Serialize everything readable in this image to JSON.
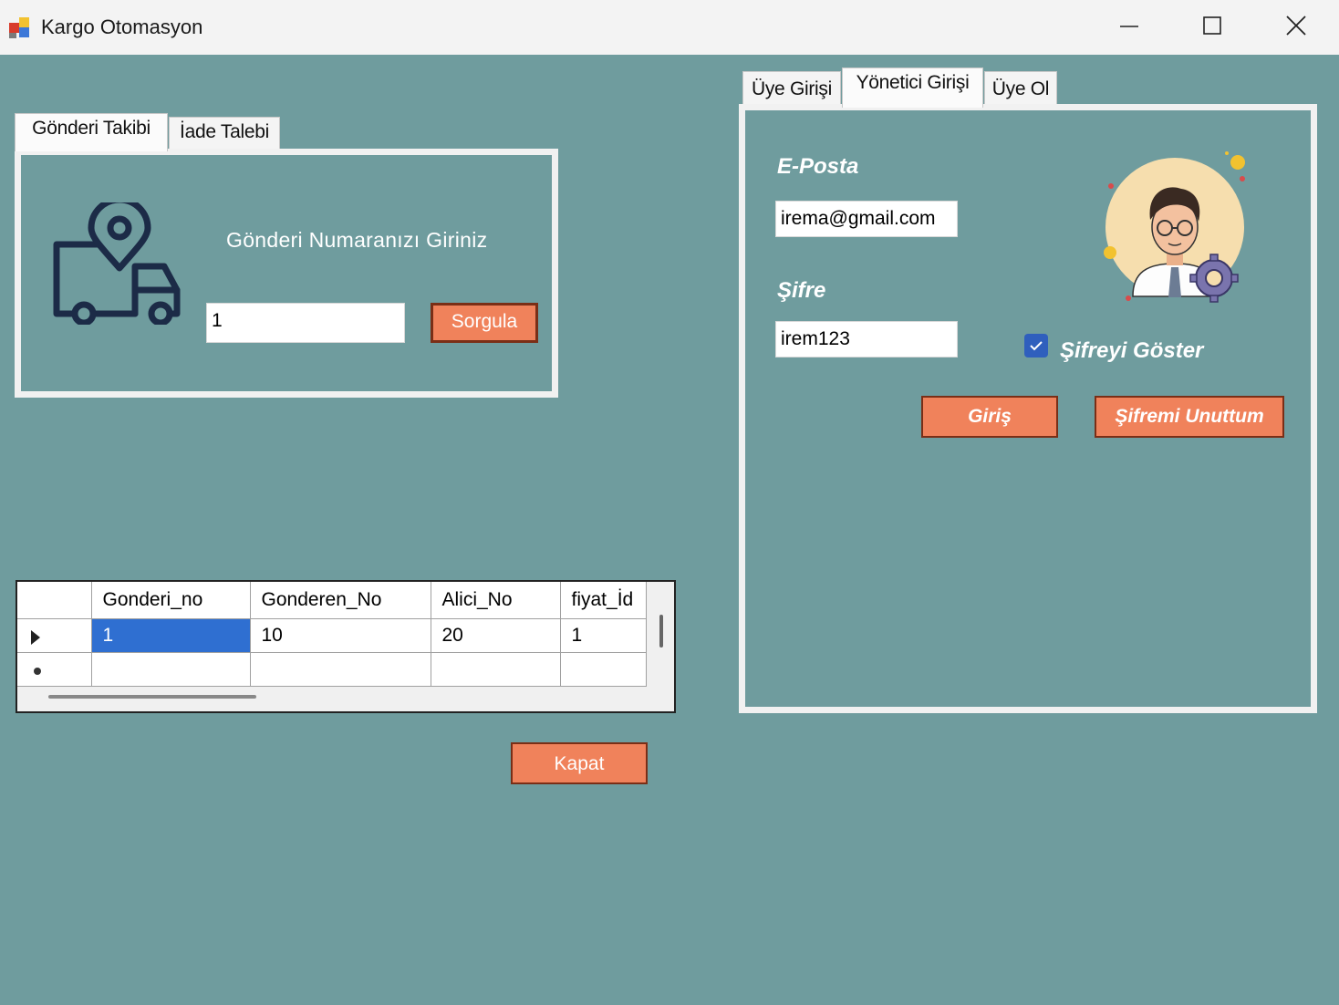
{
  "window": {
    "title": "Kargo Otomasyon"
  },
  "left_tabs": [
    {
      "label": "Gönderi Takibi",
      "active": true
    },
    {
      "label": "İade Talebi",
      "active": false
    }
  ],
  "tracking": {
    "prompt": "Gönderi Numaranızı Giriniz",
    "input_value": "1",
    "query_button": "Sorgula"
  },
  "grid": {
    "columns": [
      "Gonderi_no",
      "Gonderen_No",
      "Alici_No",
      "fiyat_İd"
    ],
    "rows": [
      [
        "1",
        "10",
        "20",
        "1"
      ],
      [
        "",
        "",
        "",
        ""
      ]
    ]
  },
  "close_button": "Kapat",
  "right_tabs": [
    {
      "label": "Üye Girişi",
      "active": false
    },
    {
      "label": "Yönetici Girişi",
      "active": true
    },
    {
      "label": "Üye Ol",
      "active": false
    }
  ],
  "login": {
    "email_label": "E-Posta",
    "email_value": "irema@gmail.com",
    "password_label": "Şifre",
    "password_value": "irem123",
    "show_password_label": "Şifreyi Göster",
    "show_password_checked": true,
    "login_button": "Giriş",
    "forgot_button": "Şifremi Unuttum"
  },
  "colors": {
    "background": "#6f9c9e",
    "button": "#f0825b",
    "selection": "#2f6fd1"
  }
}
